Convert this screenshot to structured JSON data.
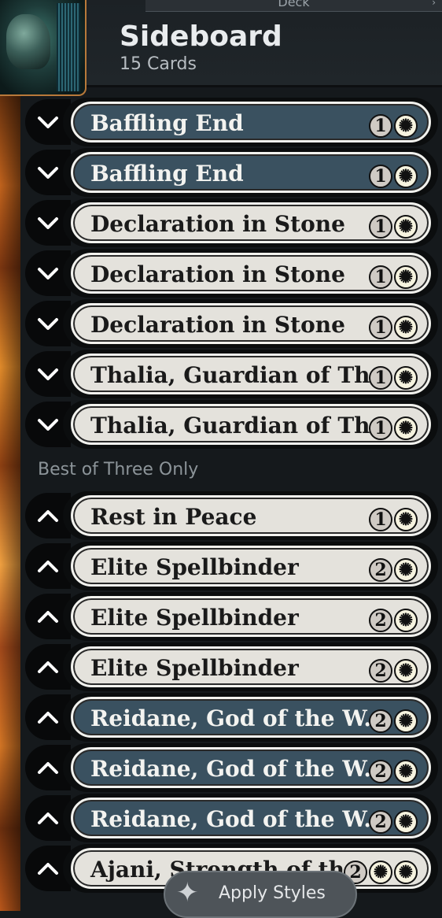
{
  "header": {
    "tab_label": "Deck",
    "title": "Sideboard",
    "card_count": "15 Cards"
  },
  "section_label": "Best of Three Only",
  "cards": [
    {
      "name": "Baffling End",
      "cost": [
        "1",
        "W"
      ],
      "frame": "blue",
      "toggle": "chevron-down"
    },
    {
      "name": "Baffling End",
      "cost": [
        "1",
        "W"
      ],
      "frame": "blue",
      "toggle": "chevron-down"
    },
    {
      "name": "Declaration in Stone",
      "cost": [
        "1",
        "W"
      ],
      "frame": "white",
      "toggle": "chevron-down"
    },
    {
      "name": "Declaration in Stone",
      "cost": [
        "1",
        "W"
      ],
      "frame": "white",
      "toggle": "chevron-down"
    },
    {
      "name": "Declaration in Stone",
      "cost": [
        "1",
        "W"
      ],
      "frame": "white",
      "toggle": "chevron-down"
    },
    {
      "name": "Thalia, Guardian of Th...",
      "cost": [
        "1",
        "W"
      ],
      "frame": "white",
      "toggle": "chevron-down"
    },
    {
      "name": "Thalia, Guardian of Th...",
      "cost": [
        "1",
        "W"
      ],
      "frame": "white",
      "toggle": "chevron-down"
    },
    {
      "name": "Rest in Peace",
      "cost": [
        "1",
        "W"
      ],
      "frame": "white",
      "toggle": "chevron-up"
    },
    {
      "name": "Elite Spellbinder",
      "cost": [
        "2",
        "W"
      ],
      "frame": "white",
      "toggle": "chevron-up"
    },
    {
      "name": "Elite Spellbinder",
      "cost": [
        "2",
        "W"
      ],
      "frame": "white",
      "toggle": "chevron-up"
    },
    {
      "name": "Elite Spellbinder",
      "cost": [
        "2",
        "W"
      ],
      "frame": "white",
      "toggle": "chevron-up"
    },
    {
      "name": "Reidane, God of the W...",
      "cost": [
        "2",
        "W"
      ],
      "frame": "blue",
      "toggle": "chevron-up"
    },
    {
      "name": "Reidane, God of the W...",
      "cost": [
        "2",
        "W"
      ],
      "frame": "blue",
      "toggle": "chevron-up"
    },
    {
      "name": "Reidane, God of the W...",
      "cost": [
        "2",
        "W"
      ],
      "frame": "blue",
      "toggle": "chevron-up"
    },
    {
      "name": "Ajani, Strength of th...",
      "cost": [
        "2",
        "W",
        "W"
      ],
      "frame": "white",
      "toggle": "chevron-up"
    }
  ],
  "apply_button": {
    "label": "Apply Styles",
    "icon": "sparkle-icon"
  },
  "colors": {
    "background": "#15191c",
    "blue_frame": "#3a5160",
    "white_frame": "#e4e2dc"
  }
}
